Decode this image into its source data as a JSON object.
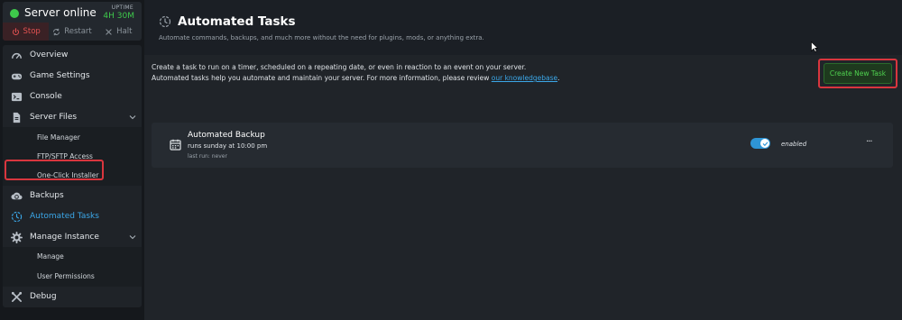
{
  "server": {
    "status": "Server online",
    "uptime_label": "UPTIME",
    "uptime_value": "4H 30M",
    "status_color": "#3ec84b",
    "power": {
      "stop": "Stop",
      "restart": "Restart",
      "halt": "Halt"
    }
  },
  "sidebar": {
    "items": [
      {
        "label": "Overview",
        "icon": "gauge-icon"
      },
      {
        "label": "Game Settings",
        "icon": "gamepad-icon"
      },
      {
        "label": "Console",
        "icon": "terminal-icon"
      },
      {
        "label": "Server Files",
        "icon": "file-icon"
      },
      {
        "label": "Backups",
        "icon": "cloud-backup-icon"
      },
      {
        "label": "Automated Tasks",
        "icon": "clock-icon"
      },
      {
        "label": "Manage Instance",
        "icon": "gear-icon"
      },
      {
        "label": "Debug",
        "icon": "wrench-icon"
      }
    ],
    "server_files_sub": [
      "File Manager",
      "FTP/SFTP Access",
      "One-Click Installer"
    ],
    "manage_instance_sub": [
      "Manage",
      "User Permissions"
    ],
    "active_item": "Automated Tasks"
  },
  "page": {
    "title": "Automated Tasks",
    "subtitle": "Automate commands, backups, and much more without the need for plugins, mods, or anything extra.",
    "info_line1": "Create a task to run on a timer, scheduled on a repeating date, or even in reaction to an event on your server.",
    "info_line2_prefix": "Automated tasks help you automate and maintain your server. For more information, please review ",
    "info_link": "our knowledgebase",
    "info_line2_suffix": ".",
    "create_button": "Create New Task"
  },
  "tasks": [
    {
      "name": "Automated Backup",
      "schedule": "runs sunday at 10:00 pm",
      "last_run": "last run: never",
      "enabled": true,
      "status": "enabled",
      "more": "···"
    }
  ],
  "colors": {
    "accent": "#3ba7e8",
    "success": "#4fd24f",
    "danger": "#e35252"
  }
}
